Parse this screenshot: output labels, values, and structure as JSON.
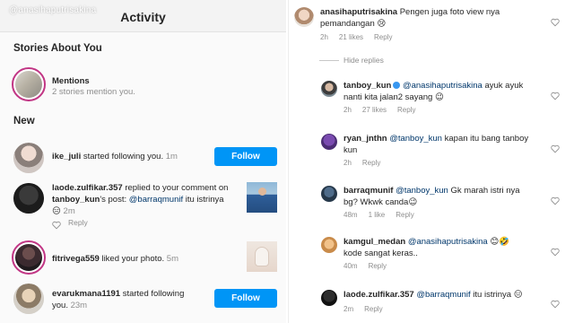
{
  "watermark": "@anasihaputrisakina",
  "left": {
    "title": "Activity",
    "stories_heading": "Stories About You",
    "mentions_title": "Mentions",
    "mentions_sub": "2 stories mention you.",
    "new_heading": "New",
    "items": [
      {
        "user": "ike_juli",
        "text": " started following you.",
        "time": " 1m",
        "button": "Follow"
      },
      {
        "user": "laode.zulfikar.357",
        "text_1": " replied to your comment on",
        "user2": "tanboy_kun",
        "text_2": "'s post: ",
        "mention": "@barraqmunif",
        "text_3": " itu istrinya",
        "emoji": "😑",
        "time": " 2m",
        "reply": "Reply"
      },
      {
        "user": "fitrivega559",
        "text": " liked your photo.",
        "time": " 5m"
      },
      {
        "user": "evarukmana1191",
        "text_1": " started following",
        "text_2": "you.",
        "time": " 23m",
        "button": "Follow"
      }
    ]
  },
  "right": {
    "hide_replies": "Hide replies",
    "comments": [
      {
        "user": "anasihaputrisakina",
        "line1": " Pengen juga foto view nya",
        "line2": "pemandangan ",
        "emoji": "😢",
        "time": "2h",
        "likes": "21 likes",
        "reply": "Reply"
      },
      {
        "user": "tanboy_kun",
        "mention": "@anasihaputrisakina",
        "line1": " ayuk ayuk",
        "line2": "nanti kita jalan2 sayang ",
        "emoji": "😉",
        "time": "2h",
        "likes": "27 likes",
        "reply": "Reply"
      },
      {
        "user": "ryan_jnthn",
        "mention": "@tanboy_kun",
        "line1": " kapan itu bang tanboy",
        "line2": "kun",
        "time": "2h",
        "reply": "Reply"
      },
      {
        "user": "barraqmunif",
        "mention": "@tanboy_kun",
        "line1": " Gk marah istri nya",
        "line2": "bg?  Wkwk canda",
        "emoji": "😉",
        "time": "48m",
        "likes": "1 like",
        "reply": "Reply"
      },
      {
        "user": "kamgul_medan",
        "mention": "@anasihaputrisakina",
        "line1": " ",
        "emoji": "😊🤣",
        "line2": "kode sangat keras..",
        "time": "40m",
        "reply": "Reply"
      },
      {
        "user": "laode.zulfikar.357",
        "mention": "@barraqmunif",
        "line1": " itu istrinya ",
        "emoji": "😑",
        "time": "2m",
        "reply": "Reply"
      }
    ]
  },
  "colors": {
    "accent": "#0095f6",
    "story_ring": "#c13584",
    "verified": "#3897f0"
  }
}
